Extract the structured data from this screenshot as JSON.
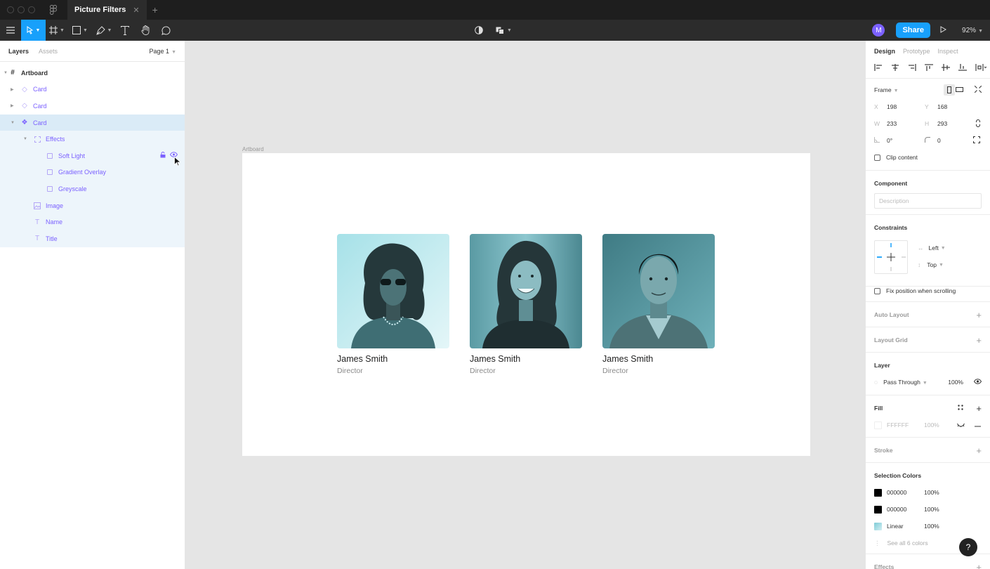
{
  "titlebar": {
    "file_title": "Picture Filters",
    "close": "✕",
    "new_tab": "+"
  },
  "toolbar": {
    "avatar_initial": "M",
    "share_label": "Share",
    "zoom": "92%"
  },
  "layers_panel": {
    "tab_layers": "Layers",
    "tab_assets": "Assets",
    "page": "Page 1",
    "items": [
      {
        "label": "Artboard"
      },
      {
        "label": "Card"
      },
      {
        "label": "Card"
      },
      {
        "label": "Card"
      },
      {
        "label": "Effects"
      },
      {
        "label": "Soft Light"
      },
      {
        "label": "Gradient Overlay"
      },
      {
        "label": "Greyscale"
      },
      {
        "label": "Image"
      },
      {
        "label": "Name"
      },
      {
        "label": "Title"
      }
    ]
  },
  "canvas": {
    "artboard_label": "Artboard",
    "cards": [
      {
        "name": "James Smith",
        "title": "Director"
      },
      {
        "name": "James Smith",
        "title": "Director"
      },
      {
        "name": "James Smith",
        "title": "Director"
      }
    ]
  },
  "design_panel": {
    "tab_design": "Design",
    "tab_prototype": "Prototype",
    "tab_inspect": "Inspect",
    "frame_label": "Frame",
    "x_key": "X",
    "x": "198",
    "y_key": "Y",
    "y": "168",
    "w_key": "W",
    "w": "233",
    "h_key": "H",
    "h": "293",
    "rotation": "0°",
    "radius": "0",
    "clip_content": "Clip content",
    "component_header": "Component",
    "description_placeholder": "Description",
    "constraints_header": "Constraints",
    "constraint_h": "Left",
    "constraint_v": "Top",
    "fix_position": "Fix position when scrolling",
    "auto_layout": "Auto Layout",
    "layout_grid": "Layout Grid",
    "layer_header": "Layer",
    "blend_mode": "Pass Through",
    "layer_opacity": "100%",
    "fill_header": "Fill",
    "fill_hex": "FFFFFF",
    "fill_opacity": "100%",
    "stroke_header": "Stroke",
    "selection_colors_header": "Selection Colors",
    "selection_colors": [
      {
        "value": "000000",
        "opacity": "100%",
        "color": "#000000"
      },
      {
        "value": "000000",
        "opacity": "100%",
        "color": "#000000"
      },
      {
        "value": "Linear",
        "opacity": "100%",
        "color": "#7ecbd6"
      }
    ],
    "see_all": "See all 6 colors",
    "effects_header": "Effects"
  },
  "colors": {
    "accent": "#18a0fb",
    "component": "#7b61ff",
    "photo_tint": "#6cc1cc"
  },
  "help": "?"
}
